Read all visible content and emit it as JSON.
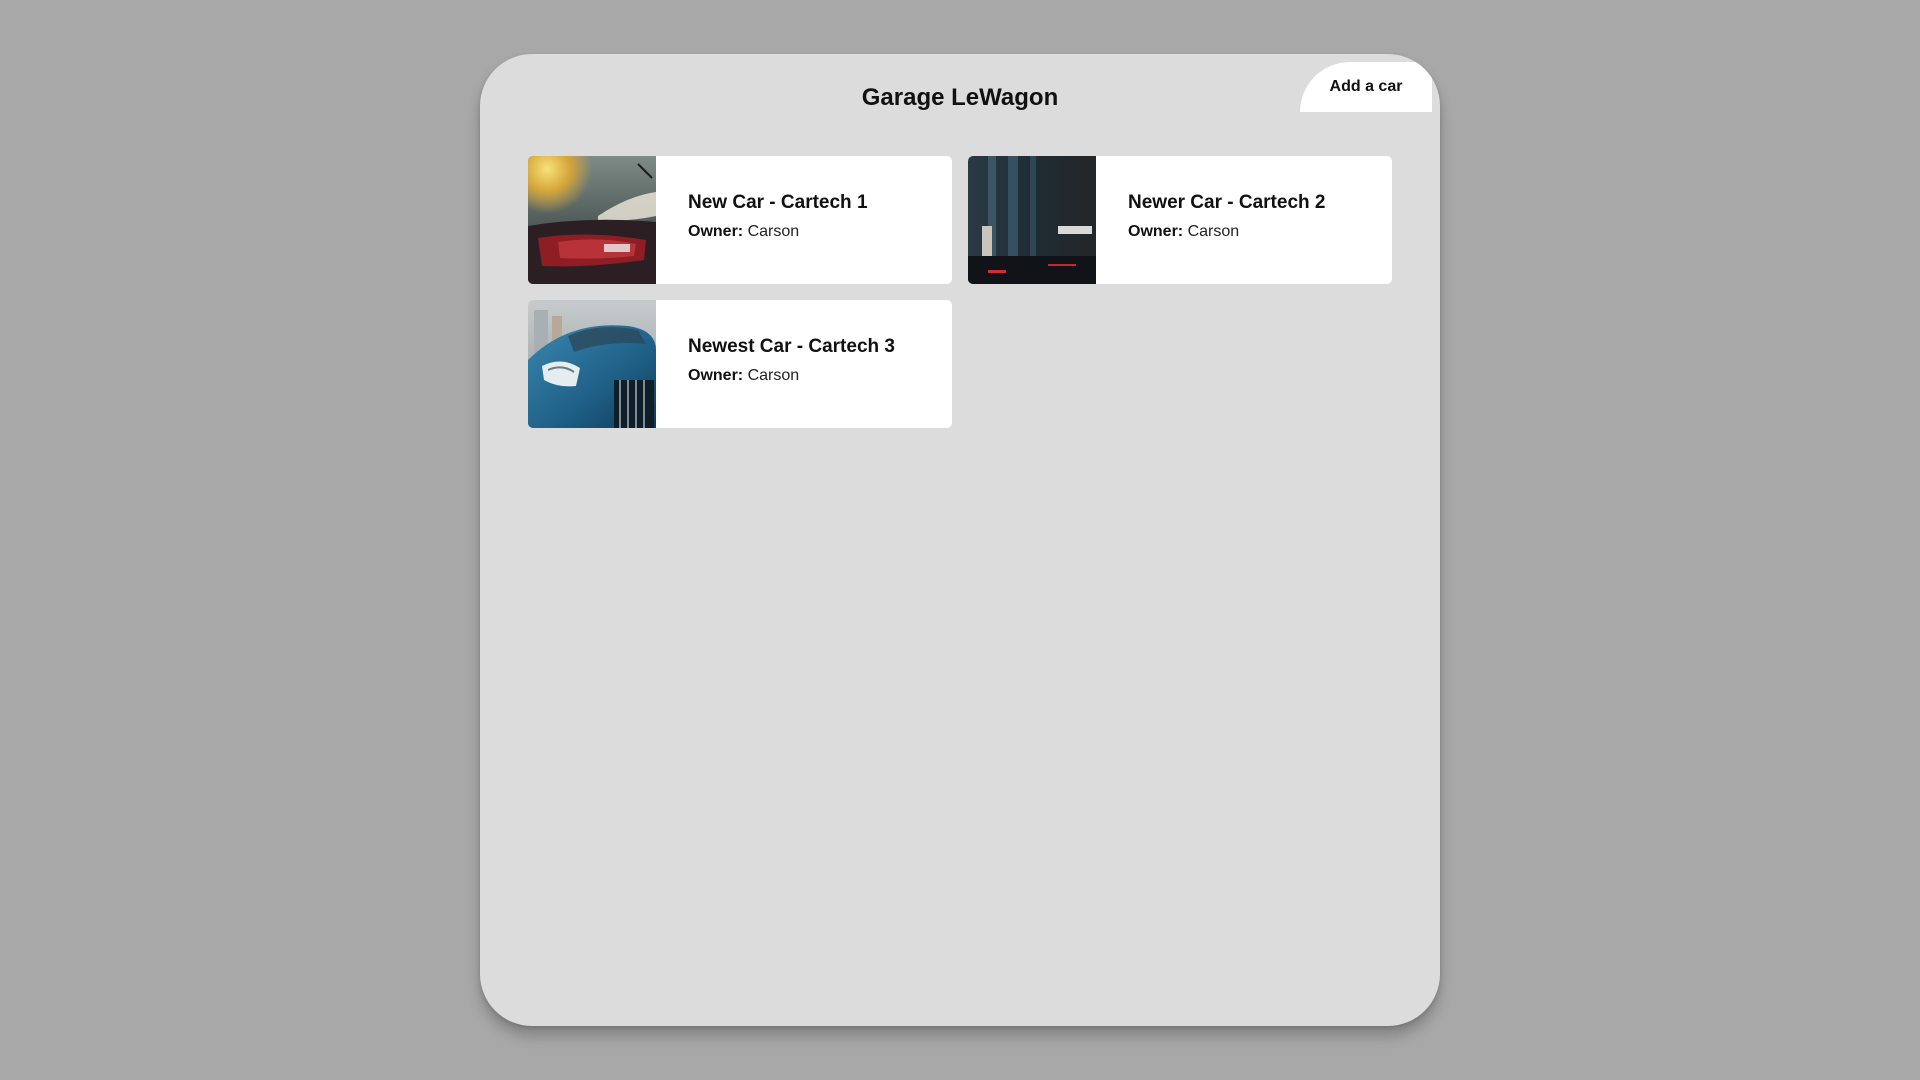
{
  "header": {
    "title": "Garage LeWagon",
    "add_button_label": "Add a car"
  },
  "cars": [
    {
      "title": "New Car - Cartech 1",
      "owner_label": "Owner:",
      "owner_name": "Carson",
      "image": "car-taillight-photo"
    },
    {
      "title": "Newer Car - Cartech 2",
      "owner_label": "Owner:",
      "owner_name": "Carson",
      "image": "car-garage-dark-photo"
    },
    {
      "title": "Newest Car - Cartech 3",
      "owner_label": "Owner:",
      "owner_name": "Carson",
      "image": "blue-sports-car-photo"
    }
  ]
}
